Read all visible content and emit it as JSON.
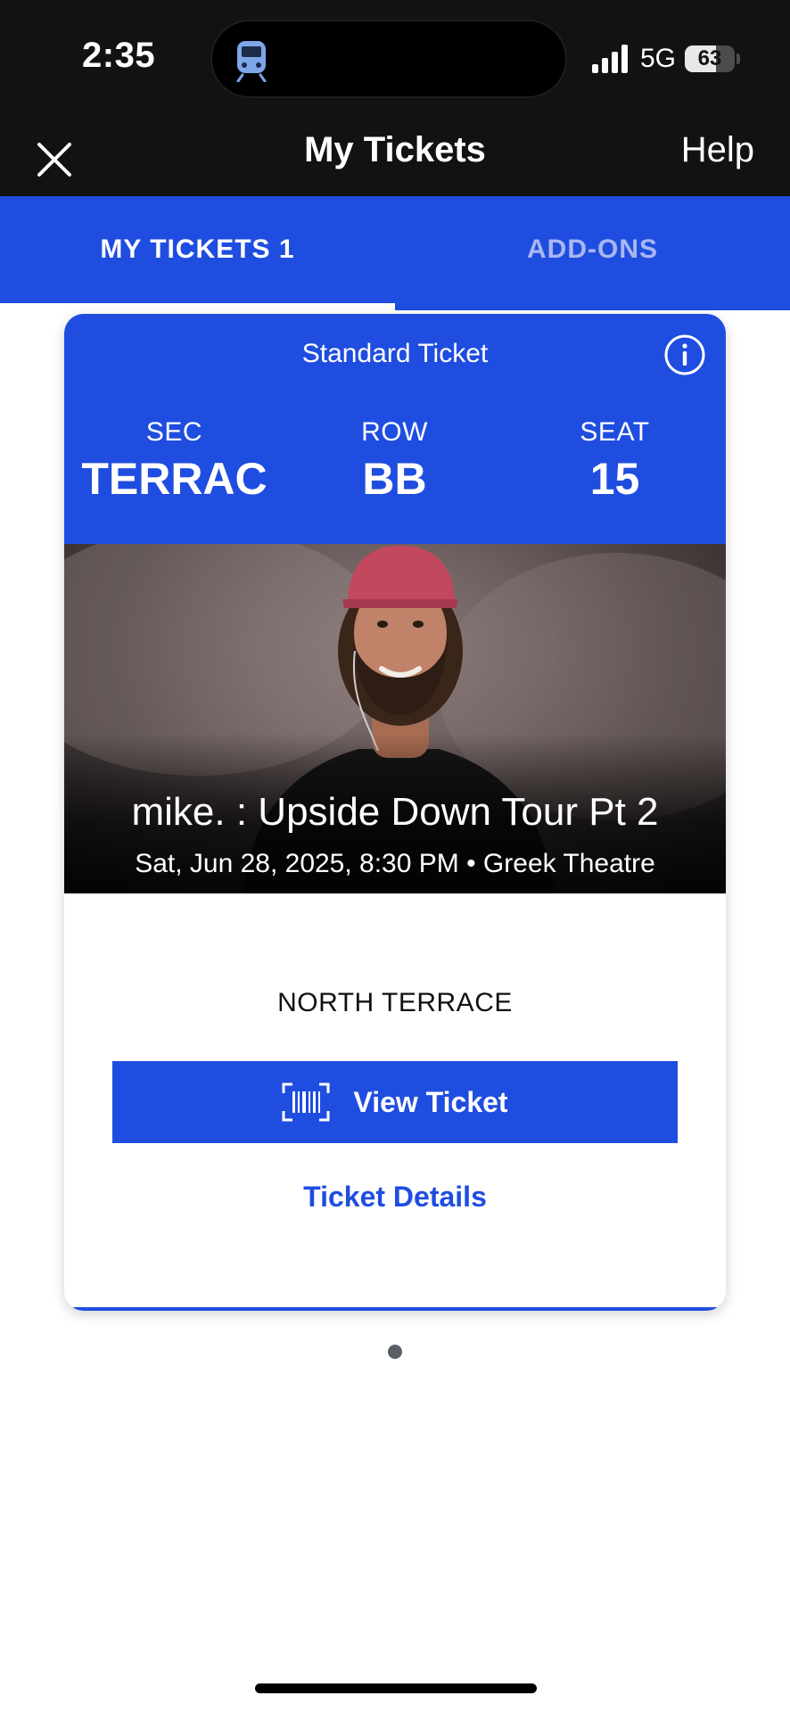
{
  "status_bar": {
    "time": "2:35",
    "network": "5G",
    "battery_percent": "63",
    "battery_level": 0.63
  },
  "header": {
    "title": "My Tickets",
    "help_label": "Help"
  },
  "tabs": [
    {
      "label": "MY TICKETS 1",
      "selected": true
    },
    {
      "label": "ADD-ONS",
      "selected": false
    }
  ],
  "ticket": {
    "type": "Standard Ticket",
    "sec_label": "SEC",
    "sec_value": "TERRAC",
    "row_label": "ROW",
    "row_value": "BB",
    "seat_label": "SEAT",
    "seat_value": "15",
    "event_title": "mike. : Upside Down Tour Pt 2",
    "event_meta": "Sat, Jun 28, 2025, 8:30 PM • Greek Theatre",
    "section_name": "NORTH TERRACE",
    "view_ticket_label": "View Ticket",
    "details_label": "Ticket Details"
  },
  "colors": {
    "brand_blue": "#1f4de0",
    "header_dark": "#121212"
  }
}
